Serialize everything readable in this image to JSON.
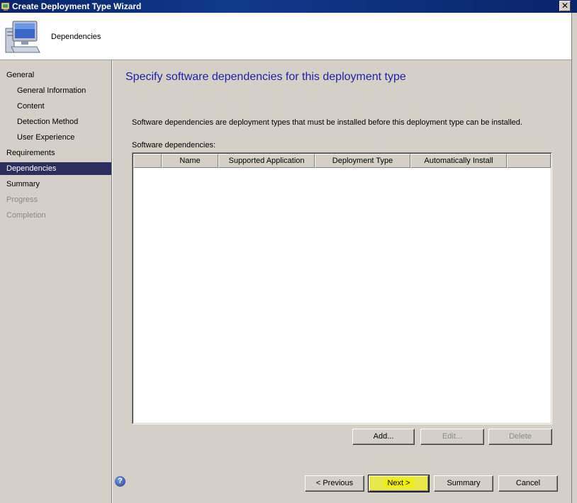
{
  "window": {
    "title": "Create Deployment Type Wizard",
    "close_glyph": "✕"
  },
  "header": {
    "title": "Dependencies"
  },
  "nav": {
    "items": [
      {
        "label": "General"
      },
      {
        "label": "General Information"
      },
      {
        "label": "Content"
      },
      {
        "label": "Detection Method"
      },
      {
        "label": "User Experience"
      },
      {
        "label": "Requirements"
      },
      {
        "label": "Dependencies"
      },
      {
        "label": "Summary"
      },
      {
        "label": "Progress"
      },
      {
        "label": "Completion"
      }
    ]
  },
  "content": {
    "title": "Specify software dependencies for this deployment type",
    "description": "Software dependencies are deployment types that must be installed before this deployment type can be installed.",
    "list_label": "Software dependencies:",
    "columns": [
      "",
      "Name",
      "Supported Application",
      "Deployment Type",
      "Automatically Install",
      ""
    ],
    "rows": []
  },
  "list_buttons": {
    "add": "Add...",
    "edit": "Edit...",
    "delete": "Delete"
  },
  "footer": {
    "help_glyph": "?",
    "previous": "< Previous",
    "next": "Next >",
    "summary": "Summary",
    "cancel": "Cancel"
  },
  "colors": {
    "title_bar": "#0a246a",
    "nav_selected": "#2e2e5e",
    "heading_text": "#1f1fa8",
    "next_highlight": "#f0f000"
  }
}
